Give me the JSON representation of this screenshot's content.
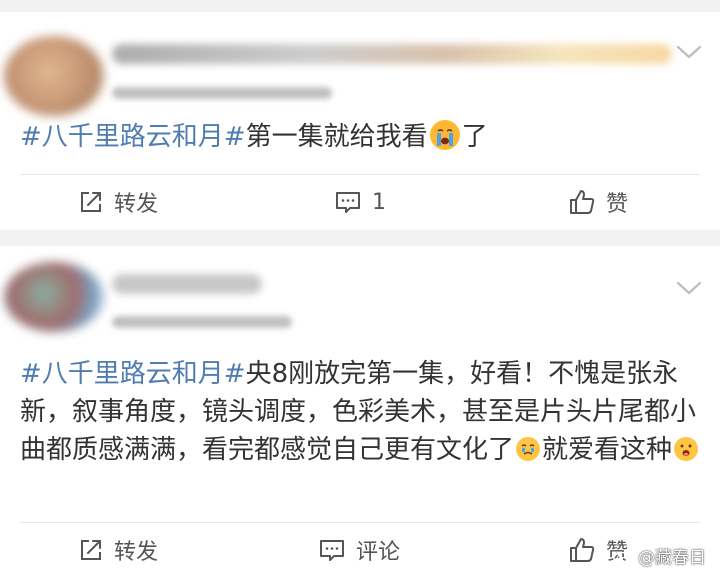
{
  "posts": [
    {
      "hashtag": "#八千里路云和月#",
      "text_before_emoji": "第一集就给我看",
      "emoji": "crying-face",
      "text_after_emoji": "了",
      "actions": {
        "repost_label": "转发",
        "comment_label": "1",
        "like_label": "赞"
      }
    },
    {
      "hashtag": "#八千里路云和月#",
      "text_before_emoji": "央8刚放完第一集，好看！不愧是张永新，叙事角度，镜头调度，色彩美术，甚至是片头片尾都小曲都质感满满，看完都感觉自己更有文化了",
      "emoji": "tearful-face",
      "text_middle": "就爱看这种",
      "emoji2": "excited-face",
      "actions": {
        "repost_label": "转发",
        "comment_label": "评论",
        "like_label": "赞"
      }
    }
  ],
  "watermark": {
    "text": "@藏春日"
  },
  "colors": {
    "hashtag": "#507daf",
    "text": "#333333",
    "icon": "#555555",
    "background": "#f2f2f2"
  }
}
